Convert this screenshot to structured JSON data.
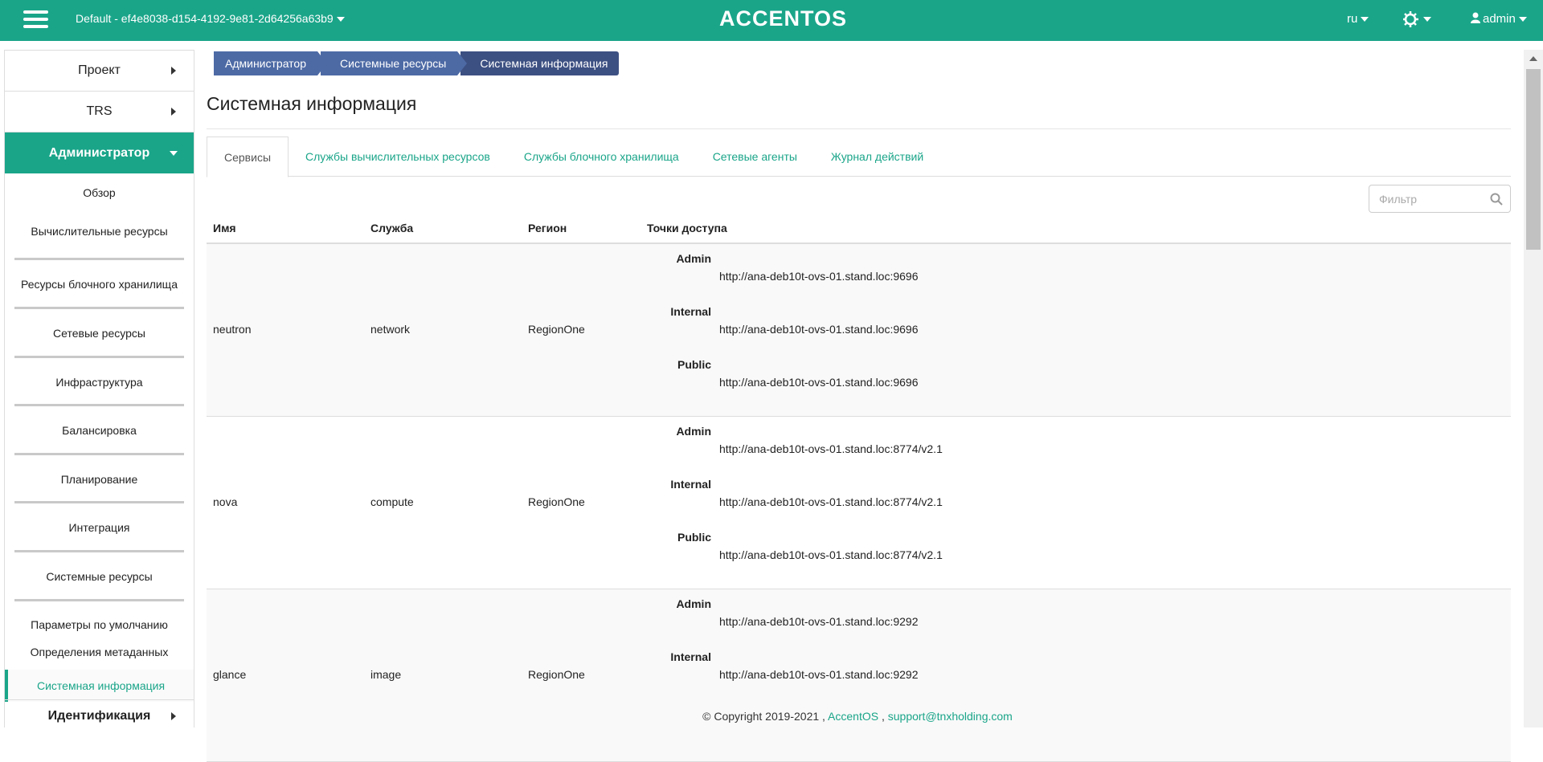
{
  "header": {
    "project": "Default - ef4e8038-d154-4192-9e81-2d64256a63b9",
    "brand": "ACCENTOS",
    "lang": "ru",
    "user": "admin"
  },
  "sidebar": {
    "top_items": [
      "Проект",
      "TRS"
    ],
    "active_section": "Администратор",
    "sub_items": [
      "Обзор",
      "Вычислительные ресурсы",
      "Ресурсы блочного хранилища",
      "Сетевые ресурсы",
      "Инфраструктура",
      "Балансировка",
      "Планирование",
      "Интеграция",
      "Системные ресурсы"
    ],
    "subsub_items": [
      "Параметры по умолчанию",
      "Определения метаданных"
    ],
    "current_item": "Системная информация",
    "bottom_item": "Идентификация"
  },
  "breadcrumb": [
    "Администратор",
    "Системные ресурсы",
    "Системная информация"
  ],
  "page": {
    "title": "Системная информация"
  },
  "tabs": [
    "Сервисы",
    "Службы вычислительных ресурсов",
    "Службы блочного хранилища",
    "Сетевые агенты",
    "Журнал действий"
  ],
  "filter": {
    "placeholder": "Фильтр"
  },
  "table": {
    "columns": [
      "Имя",
      "Служба",
      "Регион",
      "Точки доступа"
    ],
    "rows": [
      {
        "name": "neutron",
        "service": "network",
        "region": "RegionOne",
        "endpoints": [
          {
            "label": "Admin",
            "url": "http://ana-deb10t-ovs-01.stand.loc:9696"
          },
          {
            "label": "Internal",
            "url": "http://ana-deb10t-ovs-01.stand.loc:9696"
          },
          {
            "label": "Public",
            "url": "http://ana-deb10t-ovs-01.stand.loc:9696"
          }
        ]
      },
      {
        "name": "nova",
        "service": "compute",
        "region": "RegionOne",
        "endpoints": [
          {
            "label": "Admin",
            "url": "http://ana-deb10t-ovs-01.stand.loc:8774/v2.1"
          },
          {
            "label": "Internal",
            "url": "http://ana-deb10t-ovs-01.stand.loc:8774/v2.1"
          },
          {
            "label": "Public",
            "url": "http://ana-deb10t-ovs-01.stand.loc:8774/v2.1"
          }
        ]
      },
      {
        "name": "glance",
        "service": "image",
        "region": "RegionOne",
        "endpoints": [
          {
            "label": "Admin",
            "url": "http://ana-deb10t-ovs-01.stand.loc:9292"
          },
          {
            "label": "Internal",
            "url": "http://ana-deb10t-ovs-01.stand.loc:9292"
          }
        ]
      }
    ]
  },
  "footer": {
    "copyright": "© Copyright 2019-2021 ,",
    "brand_link": "AccentOS",
    "separator": ",",
    "email": "support@tnxholding.com"
  },
  "colors": {
    "accent": "#1aa589",
    "breadcrumb": "#4d6aa5",
    "breadcrumb_active": "#3d5082"
  }
}
